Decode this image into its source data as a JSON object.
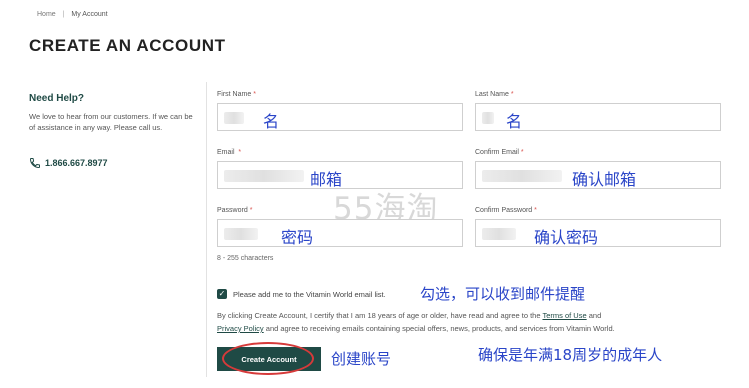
{
  "breadcrumb": {
    "home": "Home",
    "sep": "|",
    "current": "My Account"
  },
  "page": {
    "title": "CREATE AN ACCOUNT"
  },
  "help": {
    "title": "Need Help?",
    "text": "We love to hear from our customers. If we can be of assistance in any way. Please call us.",
    "phone": "1.866.667.8977"
  },
  "form": {
    "first_name": {
      "label": "First Name",
      "annotation": "名"
    },
    "last_name": {
      "label": "Last Name",
      "annotation": "名"
    },
    "email": {
      "label": "Email",
      "annotation": "邮箱"
    },
    "confirm_email": {
      "label": "Confirm Email",
      "annotation": "确认邮箱"
    },
    "password": {
      "label": "Password",
      "annotation": "密码"
    },
    "confirm_password": {
      "label": "Confirm Password",
      "annotation": "确认密码"
    },
    "required_mark": "*",
    "password_hint": "8 - 255 characters",
    "email_list_label": "Please add me to the Vitamin World email list.",
    "email_list_note": "勾选，可以收到邮件提醒",
    "email_list_checked": true,
    "legal": {
      "pre": "By clicking Create Account, I certify that I am 18 years of age or older, have read and agree to the",
      "terms": "Terms of Use",
      "and": "and",
      "privacy": "Privacy Policy",
      "post": "and agree to receiving emails containing special offers, news, products, and services from Vitamin World."
    },
    "submit_label": "Create Account",
    "submit_note": "创建账号",
    "age_note": "确保是年满18周岁的成年人"
  },
  "watermark": "55海淘",
  "colors": {
    "brand": "#1f4a45",
    "annotation": "#2a45c8",
    "highlight": "#d63a3a"
  }
}
